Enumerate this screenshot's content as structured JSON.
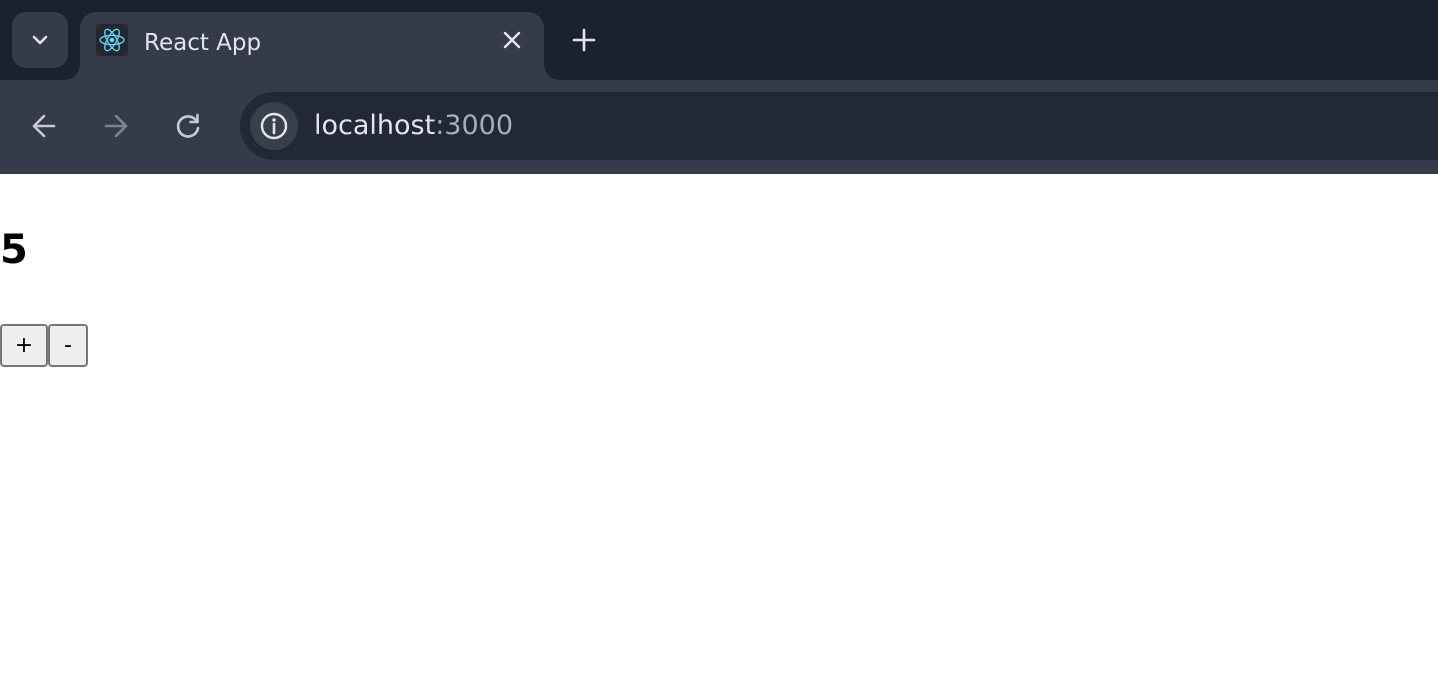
{
  "browser": {
    "tab": {
      "title": "React App",
      "favicon": "react-logo-icon"
    },
    "address_bar": {
      "host": "localhost",
      "port": ":3000"
    },
    "colors": {
      "tabstrip_bg": "#1c2130",
      "toolbar_bg": "#353b4a",
      "omnibox_bg": "#232837",
      "react_blue": "#61dafb"
    }
  },
  "page": {
    "counter_value": "5",
    "increment_label": "+",
    "decrement_label": "-"
  }
}
